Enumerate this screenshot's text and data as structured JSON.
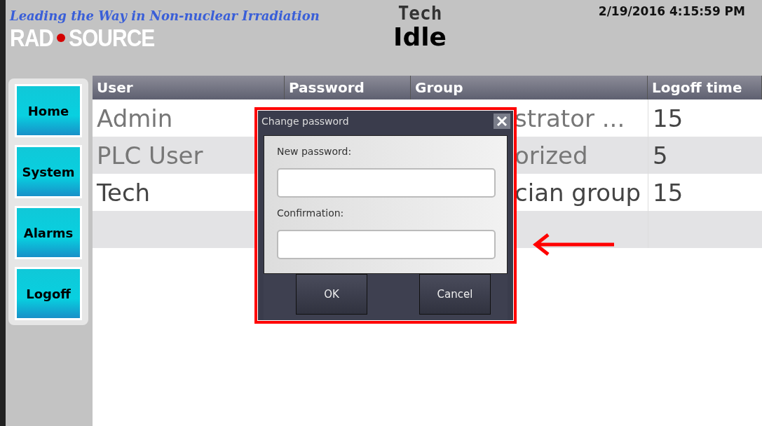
{
  "header": {
    "tagline": "Leading the Way in Non-nuclear Irradiation",
    "logo_left": "RAD",
    "logo_right": "SOURCE",
    "user": "Tech",
    "datetime": "2/19/2016 4:15:59 PM",
    "status": "Idle"
  },
  "nav": [
    {
      "label": "Home"
    },
    {
      "label": "System"
    },
    {
      "label": "Alarms"
    },
    {
      "label": "Logoff"
    }
  ],
  "table": {
    "columns": [
      "User",
      "Password",
      "Group",
      "Logoff time"
    ],
    "rows": [
      {
        "user": "Admin",
        "group": "strator ...",
        "logoff": "15",
        "active": false
      },
      {
        "user": "PLC User",
        "group": "orized",
        "logoff": "5",
        "active": false
      },
      {
        "user": "Tech",
        "group": "cian group",
        "logoff": "15",
        "active": true
      }
    ]
  },
  "dialog": {
    "title": "Change password",
    "fields": [
      {
        "label": "New password:"
      },
      {
        "label": "Confirmation:"
      }
    ],
    "buttons": [
      "OK",
      "Cancel"
    ]
  }
}
